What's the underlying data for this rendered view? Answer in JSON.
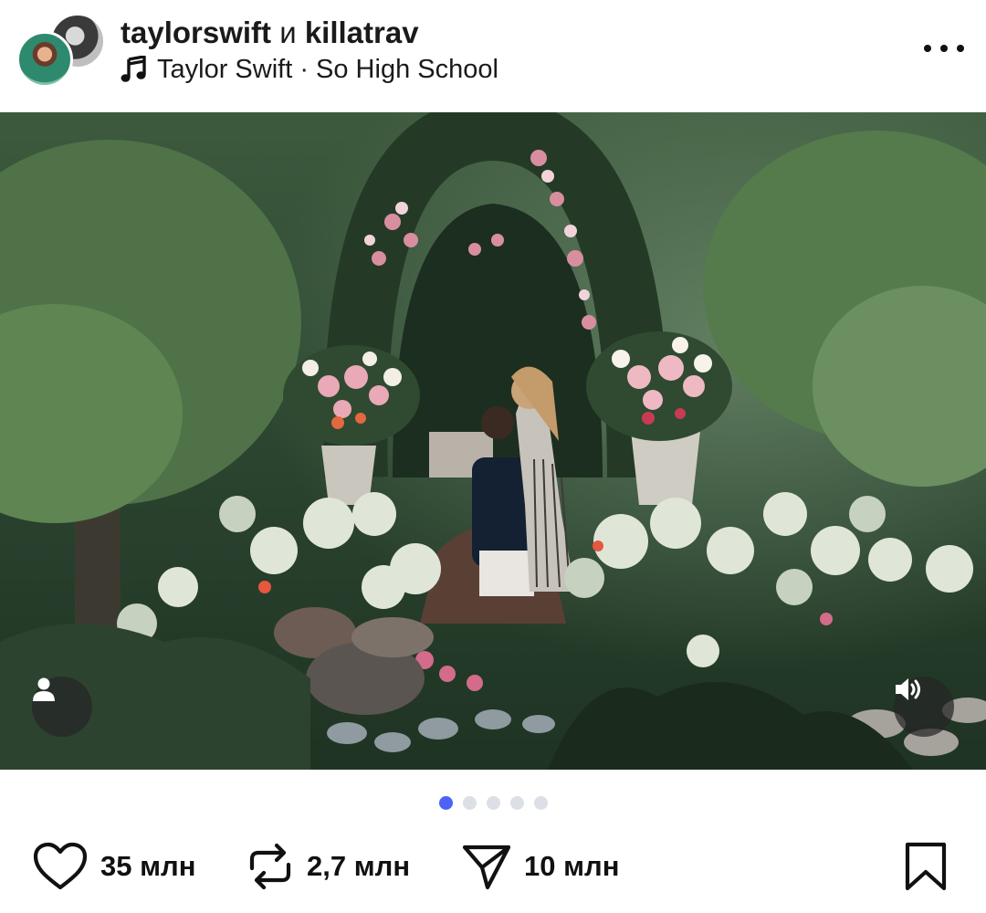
{
  "header": {
    "author_primary": "taylorswift",
    "conjunction": "и",
    "author_secondary": "killatrav",
    "music_label": "Taylor Swift · So High School",
    "avatar_primary_icon": "avatar-taylorswift",
    "avatar_secondary_icon": "avatar-killatrav",
    "more_icon": "more-horizontal-icon"
  },
  "media": {
    "description_icon": "photo",
    "user_tag_icon": "person-icon",
    "sound_icon": "speaker-icon",
    "carousel": {
      "total": 5,
      "active_index": 0
    }
  },
  "actions": {
    "likes": "35 млн",
    "reposts": "2,7 млн",
    "shares": "10 млн",
    "like_icon": "heart-icon",
    "repost_icon": "repost-icon",
    "share_icon": "send-icon",
    "bookmark_icon": "bookmark-icon"
  },
  "colors": {
    "accent": "#4d63f5",
    "dot_inactive": "#dcdfe6",
    "text": "#111111"
  }
}
